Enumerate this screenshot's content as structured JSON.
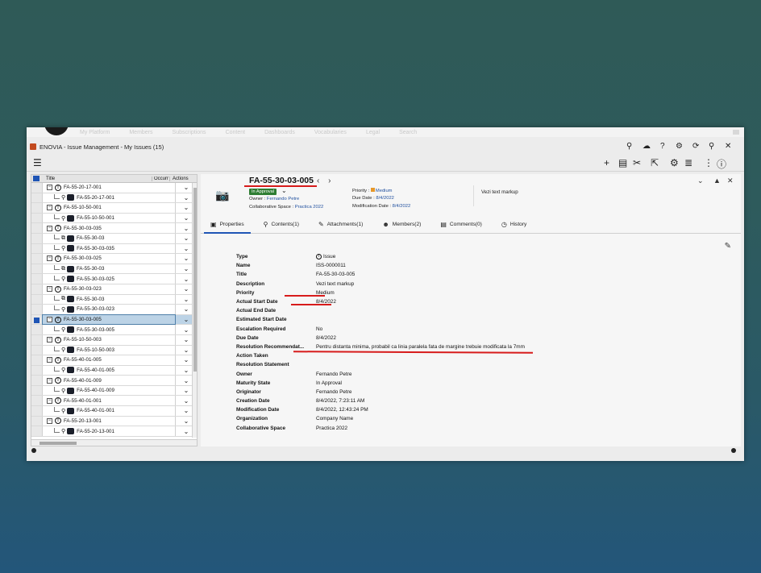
{
  "topbar": {
    "items": [
      "My Platform",
      "Members",
      "Subscriptions",
      "Content",
      "Dashboards",
      "Vocabularies",
      "Legal",
      "Search"
    ]
  },
  "app": {
    "title": "ENOVIA - Issue Management - My Issues (15)"
  },
  "icons": {
    "search": "search-icon",
    "cloud": "cloud-icon",
    "help": "help-icon",
    "settings": "gear-icon",
    "refresh": "refresh-icon",
    "pin": "pin-icon",
    "close": "close-icon",
    "add": "plus-icon",
    "export": "document-icon",
    "tools": "tools-icon",
    "select": "cursor-select-icon",
    "config": "gear-icon",
    "list": "list-view-icon",
    "more": "more-icon",
    "info": "info-icon",
    "camera": "camera-icon",
    "pencil": "pencil-icon"
  },
  "tree": {
    "columns": {
      "title": "Title",
      "occurrence": "Occurr",
      "actions": "Actions"
    },
    "rows": [
      {
        "level": 0,
        "label": "FA-55-20-17-001",
        "kind": "issue"
      },
      {
        "level": 1,
        "label": "FA-55-20-17-001",
        "kind": "part"
      },
      {
        "level": 0,
        "label": "FA-55-10-50-001",
        "kind": "issue"
      },
      {
        "level": 1,
        "label": "FA-55-10-50-001",
        "kind": "part"
      },
      {
        "level": 0,
        "label": "FA-55-30-03-035",
        "kind": "issue"
      },
      {
        "level": 1,
        "label": "FA-55-30-03",
        "kind": "assembly"
      },
      {
        "level": 1,
        "label": "FA-55-30-03-035",
        "kind": "part"
      },
      {
        "level": 0,
        "label": "FA-55-30-03-025",
        "kind": "issue"
      },
      {
        "level": 1,
        "label": "FA-55-30-03",
        "kind": "assembly"
      },
      {
        "level": 1,
        "label": "FA-55-30-03-025",
        "kind": "part"
      },
      {
        "level": 0,
        "label": "FA-55-30-03-023",
        "kind": "issue"
      },
      {
        "level": 1,
        "label": "FA-55-30-03",
        "kind": "assembly"
      },
      {
        "level": 1,
        "label": "FA-55-30-03-023",
        "kind": "part"
      },
      {
        "level": 0,
        "label": "FA-55-30-03-005",
        "kind": "issue",
        "selected": true
      },
      {
        "level": 1,
        "label": "FA-55-30-03-005",
        "kind": "part"
      },
      {
        "level": 0,
        "label": "FA-55-10-50-003",
        "kind": "issue"
      },
      {
        "level": 1,
        "label": "FA-55-10-50-003",
        "kind": "part"
      },
      {
        "level": 0,
        "label": "FA-55-40-01-005",
        "kind": "issue"
      },
      {
        "level": 1,
        "label": "FA-55-40-01-005",
        "kind": "part"
      },
      {
        "level": 0,
        "label": "FA-55-40-01-009",
        "kind": "issue"
      },
      {
        "level": 1,
        "label": "FA-55-40-01-009",
        "kind": "part"
      },
      {
        "level": 0,
        "label": "FA-55-40-01-001",
        "kind": "issue"
      },
      {
        "level": 1,
        "label": "FA-55-40-01-001",
        "kind": "part"
      },
      {
        "level": 0,
        "label": "FA-55-20-13-001",
        "kind": "issue"
      },
      {
        "level": 1,
        "label": "FA-55-20-13-001",
        "kind": "part"
      }
    ]
  },
  "header": {
    "title": "FA-55-30-03-005",
    "state": "In Approval",
    "owner_label": "Owner :",
    "owner": "Fernando Petre",
    "space_label": "Collaborative Space :",
    "space": "Practica 2022",
    "priority_label": "Priority :",
    "priority": "Medium",
    "due_label": "Due Date :",
    "due": "8/4/2022",
    "mod_label": "Modification Date :",
    "mod": "8/4/2022",
    "description": "Vezi text markup"
  },
  "tabs": [
    {
      "label": "Properties",
      "icon": "properties-icon",
      "active": true
    },
    {
      "label": "Contents(1)",
      "icon": "location-pin-icon"
    },
    {
      "label": "Attachments(1)",
      "icon": "paperclip-icon"
    },
    {
      "label": "Members(2)",
      "icon": "members-icon"
    },
    {
      "label": "Comments(0)",
      "icon": "comments-icon"
    },
    {
      "label": "History",
      "icon": "history-icon"
    }
  ],
  "properties": [
    {
      "key": "Type",
      "value": "Issue"
    },
    {
      "key": "Name",
      "value": "ISS-0000011"
    },
    {
      "key": "Title",
      "value": "FA-55-30-03-005"
    },
    {
      "key": "Description",
      "value": "Vezi text markup"
    },
    {
      "key": "Priority",
      "value": "Medium"
    },
    {
      "key": "Actual Start Date",
      "value": "8/4/2022"
    },
    {
      "key": "Actual End Date",
      "value": ""
    },
    {
      "key": "Estimated Start Date",
      "value": ""
    },
    {
      "key": "Escalation Required",
      "value": "No"
    },
    {
      "key": "Due Date",
      "value": "8/4/2022"
    },
    {
      "key": "Resolution Recommendat...",
      "value": "Pentru distanta minima, probabil ca linia paralela fata de margine trebuie modificata la 7mm"
    },
    {
      "key": "Action Taken",
      "value": ""
    },
    {
      "key": "Resolution Statement",
      "value": ""
    },
    {
      "key": "Owner",
      "value": "Fernando Petre"
    },
    {
      "key": "Maturity State",
      "value": "In Approval"
    },
    {
      "key": "Originator",
      "value": "Fernando Petre"
    },
    {
      "key": "Creation Date",
      "value": "8/4/2022, 7:23:11 AM"
    },
    {
      "key": "Modification Date",
      "value": "8/4/2022, 12:43:24 PM"
    },
    {
      "key": "Organization",
      "value": "Company Name"
    },
    {
      "key": "Collaborative Space",
      "value": "Practica 2022"
    }
  ],
  "colors": {
    "accent": "#1f55b5",
    "state_green": "#2e7d32",
    "markup_red": "#d71b1b",
    "link_blue": "#1f4f9e"
  }
}
